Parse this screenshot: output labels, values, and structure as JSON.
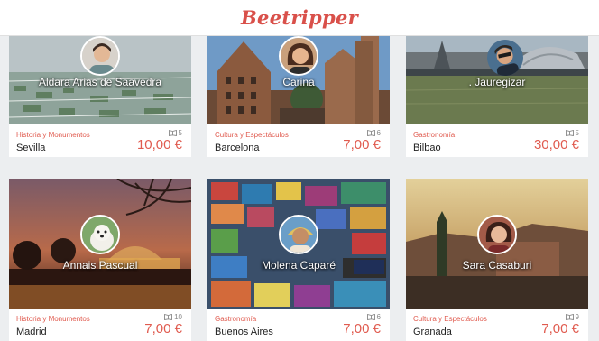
{
  "app": {
    "logo": "Beetripper"
  },
  "icons": {
    "review": "book-icon",
    "avatar": "user-avatar"
  },
  "colors": {
    "brand": "#d9504a",
    "accent": "#e05a4e"
  },
  "tours": [
    {
      "guide": "Aldara Arias de Saavedra",
      "category": "Historia y Monumentos",
      "city": "Sevilla",
      "reviews": "5",
      "price": "10,00 €"
    },
    {
      "guide": "Carina",
      "category": "Cultura y Espectáculos",
      "city": "Barcelona",
      "reviews": "6",
      "price": "7,00 €"
    },
    {
      "guide": ". Jauregizar",
      "category": "Gastronomía",
      "city": "Bilbao",
      "reviews": "5",
      "price": "30,00 €"
    },
    {
      "guide": "Annais Pascual",
      "category": "Historia y Monumentos",
      "city": "Madrid",
      "reviews": "10",
      "price": "7,00 €"
    },
    {
      "guide": "Molena Caparé",
      "category": "Gastronomía",
      "city": "Buenos Aires",
      "reviews": "6",
      "price": "7,00 €"
    },
    {
      "guide": "Sara Casaburi",
      "category": "Cultura y Espectáculos",
      "city": "Granada",
      "reviews": "9",
      "price": "7,00 €"
    }
  ]
}
